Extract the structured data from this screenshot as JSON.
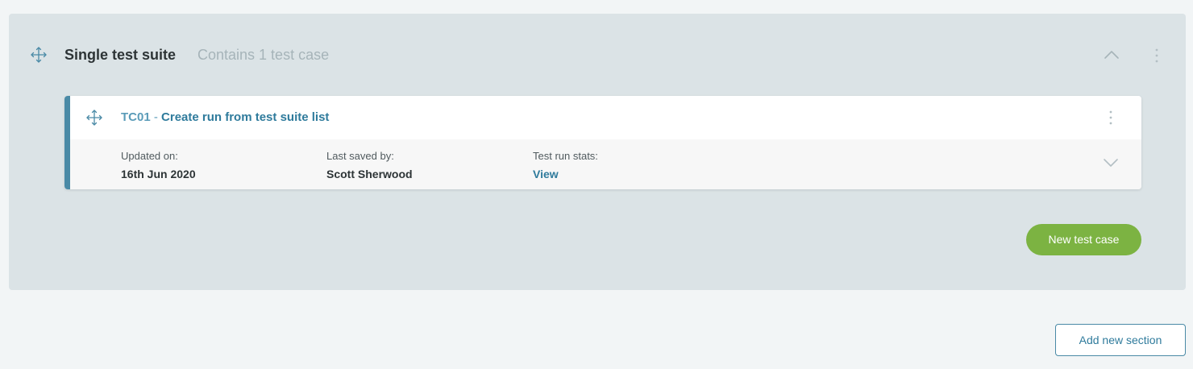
{
  "suite": {
    "title": "Single test suite",
    "subtitle": "Contains 1 test case",
    "collapse_icon": "chevron-up-icon",
    "menu_icon": "kebab-menu-icon",
    "drag_icon": "move-arrows-icon"
  },
  "test_case": {
    "id": "TC01",
    "separator": " - ",
    "name": "Create run from test suite list",
    "updated_label": "Updated on:",
    "updated_value": "16th Jun 2020",
    "saved_label": "Last saved by:",
    "saved_value": "Scott Sherwood",
    "stats_label": "Test run stats:",
    "stats_link": "View",
    "expand_icon": "chevron-down-icon",
    "menu_icon": "kebab-menu-icon",
    "drag_icon": "move-arrows-icon"
  },
  "actions": {
    "new_test_case": "New test case",
    "add_new_section": "Add new section"
  },
  "colors": {
    "accent": "#4a8aa6",
    "link": "#2f7b9c",
    "success": "#7cb342",
    "suite_bg": "#dbe3e6",
    "page_bg": "#f2f5f6"
  }
}
